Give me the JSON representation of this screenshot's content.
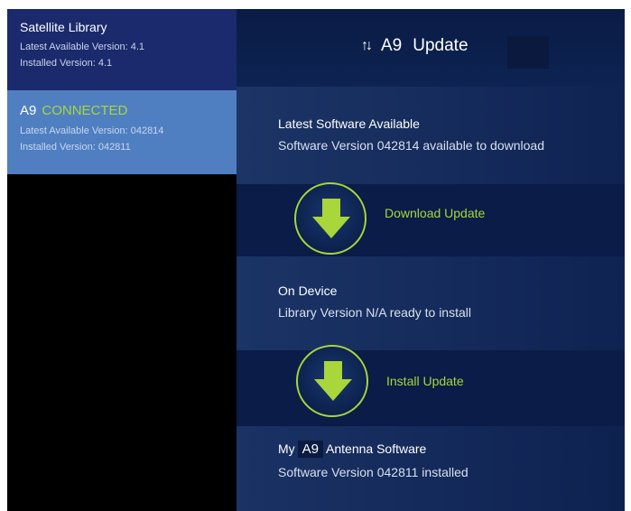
{
  "sidebar": {
    "library": {
      "title": "Satellite Library",
      "latest": "Latest Available Version: 4.1",
      "installed": "Installed Version: 4.1"
    },
    "device": {
      "model": "A9",
      "status": "CONNECTED",
      "latest": "Latest Available Version: 042814",
      "installed": "Installed Version: 042811"
    }
  },
  "header": {
    "icon": "up-down-arrows-icon",
    "model": "A9",
    "title": "Update"
  },
  "latest_section": {
    "title": "Latest Software Available",
    "subtitle": "Software Version 042814 available to download"
  },
  "download": {
    "icon": "download-arrow-icon",
    "label": "Download Update"
  },
  "ondevice_section": {
    "title": "On Device",
    "subtitle": "Library Version N/A ready to install"
  },
  "install": {
    "icon": "install-arrow-icon",
    "label": "Install Update"
  },
  "antenna_section": {
    "prefix": "My",
    "model": "A9",
    "suffix": "Antenna Software",
    "subtitle": "Software Version 042811 installed"
  },
  "colors": {
    "accent": "#a8d63b",
    "sidebar_library_bg": "#1b2a6c",
    "sidebar_device_bg": "#4f7fc1",
    "main_bg": "#0c1e4a"
  }
}
